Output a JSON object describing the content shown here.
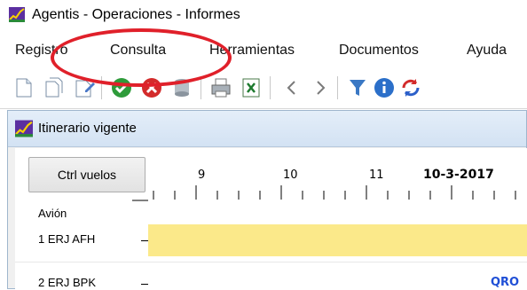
{
  "window": {
    "title": "Agentis - Operaciones - Informes"
  },
  "menu": {
    "items": [
      {
        "id": "registro",
        "label": "Registro"
      },
      {
        "id": "consulta",
        "label": "Consulta"
      },
      {
        "id": "herramientas",
        "label": "Herramientas"
      },
      {
        "id": "documentos",
        "label": "Documentos"
      },
      {
        "id": "ayuda",
        "label": "Ayuda"
      }
    ]
  },
  "toolbar": {
    "icons": [
      "new-doc-icon",
      "copy-doc-icon",
      "edit-doc-icon",
      "accept-icon",
      "cancel-icon",
      "database-icon",
      "print-icon",
      "excel-export-icon",
      "previous-icon",
      "next-icon",
      "filter-icon",
      "info-icon",
      "refresh-icon"
    ]
  },
  "inner_window": {
    "title": "Itinerario vigente",
    "ctrl_button": "Ctrl vuelos",
    "timeline": {
      "hours": [
        "9",
        "10",
        "11"
      ],
      "date": "10-3-2017"
    },
    "column_header": "Avión",
    "rows": [
      {
        "label": "1 ERJ AFH"
      },
      {
        "label": "2 ERJ BPK",
        "tag": "QRO"
      }
    ]
  },
  "colors": {
    "highlight_ellipse": "#e0202a",
    "flight_bar": "#fbe98a",
    "tag_text": "#1f4fd6",
    "menu_hover": "#dcebfa"
  }
}
